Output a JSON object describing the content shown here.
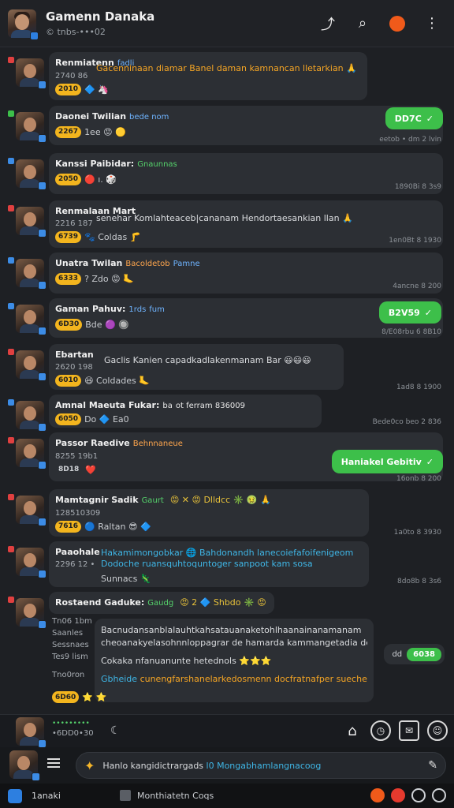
{
  "header": {
    "title": "Gamenn Danaka",
    "subtitle": "© tnbs-•••02"
  },
  "messages": [
    {
      "name": "Renmiatenn",
      "tag": "fadli",
      "sub": "2740 86",
      "text": "Gacenninaan diamar Banel daman kamnancan lletarkian 🙏",
      "react_count": "2010",
      "reacts": "🔷 🦄",
      "dot": "#e04040",
      "time": ""
    },
    {
      "name": "Daonei Twilian",
      "tag": "bede nom",
      "sub": "",
      "text": "",
      "react_count": "2267",
      "reacts": "1ee 😡 🟡",
      "dot": "#3dbf4a",
      "time": "eetob • dm 2 lvin",
      "reply": "DD7C"
    },
    {
      "name": "Kanssi Paibidar:",
      "tag": "Gnaunnas",
      "sub": "",
      "text": "",
      "react_count": "2050",
      "reacts": "🔴 ı. 🎲",
      "dot": "#3c8ce6",
      "time": "1890Bi 8 3s9"
    },
    {
      "name": "Renmalaan Mart",
      "tag": "",
      "sub": "2216 187",
      "text": "senehar Komlahteaceb|cananam Hendortaesankian llan 🙏",
      "react_count": "6739",
      "reacts": "🐾 Coldas 🦵",
      "dot": "#e04040",
      "time": "1en0Bt 8 1930"
    },
    {
      "name": "Unatra Twilan",
      "tag": "Bacoldetob",
      "tag2": "Pamne",
      "sub": "",
      "text": "",
      "react_count": "6333",
      "reacts": "? Zdo 😡 🦶",
      "dot": "#3c8ce6",
      "time": "4ancne 8 200"
    },
    {
      "name": "Gaman Pahuv:",
      "tag": "1rds",
      "tag2": "fum",
      "sub": "",
      "text": "",
      "react_count": "6D30",
      "reacts": "Bde 🟣 🔘",
      "dot": "#3c8ce6",
      "time": "8/E08rbu 6 8B10",
      "reply": "B2V59"
    },
    {
      "name": "Ebartan",
      "tag": "",
      "sub": "2620 198",
      "text": "Gaclis Kanien capadkadlakenmanam Bar 😃😃😃",
      "react_count": "6010",
      "reacts": "😆 Coldades 🦶",
      "dot": "#e04040",
      "time": "1ad8 8 1900"
    },
    {
      "name": "Amnal Maeuta Fukar:",
      "tag": "ba",
      "tag2": "ot ferram 836009",
      "sub": "",
      "text": "",
      "react_count": "6050",
      "reacts": "Do 🔷 Ea0",
      "dot": "#3c8ce6",
      "time": "Bede0co beo 2 836"
    },
    {
      "name": "Passor Raedive",
      "tag": "Behnnaneue",
      "sub": "8255 19b1",
      "text": "",
      "react_count": "8D18",
      "reacts": "❤️",
      "dot": "#e04040",
      "time": "16onb 8 200",
      "reply": "Haniakel Gebitiv"
    },
    {
      "name": "Mamtagnir Sadik",
      "tag": "Gaurt",
      "sub": "128510309",
      "text": "",
      "react_count": "7616",
      "reacts": "🔵 Raltan 😎 🔷",
      "dot": "#e04040",
      "time": "1a0to 8 3930",
      "extra": "😡 ✕ 😡 Dlldcc ✳️ 🤢 🙏"
    },
    {
      "name": "Paaohale",
      "tag": "",
      "sub": "2296 12 •",
      "text": "Hakamimongobkar 🌐 Bahdonandh lanecoiefafoifenigeom",
      "text2": "Dodoche ruansquhtoquntoger sanpoot kam sosa",
      "react_count": "",
      "reacts": "Sunnacs 🦎",
      "dot": "#e04040",
      "time": "8do8b 8 3s6"
    },
    {
      "name": "Rostaend Gaduke:",
      "tag": "Gaudg",
      "sub": "",
      "text": "",
      "react_count": "",
      "reacts": "",
      "dot": "#e04040",
      "time": "",
      "extra": "😡 2 🔷 Shbdo ✳️ 😡"
    }
  ],
  "thread": {
    "labels": [
      "Tn06 1bm",
      "Saanles",
      "Sessnaes",
      "Tes9 lism",
      "Tno0ron"
    ],
    "line1": "Bacnudansanblalauhtkahsatauanaketohlhaanainanamanam",
    "line2": "cheoanakyelasohnnloppagrar de hamarda kammangetadia delkaij",
    "line3": "Cokaka nfanuanunte hetednols ⭐⭐⭐",
    "line4a": "Gbheide",
    "line4b": "cunengfarshanelarkedosmenn docfratnafper sueche",
    "react_count": "6D60",
    "reacts": "⭐ ⭐",
    "side_reply": "dd",
    "side_inner": "6038"
  },
  "composebar": {
    "line1": "•••••••••",
    "line2": "•6DD0•30",
    "reply_icon": "☾"
  },
  "input": {
    "text_main": "Hanlo kangidictrargads ",
    "text_hl": "l0 Mongabhamlangnacoog",
    "send_icon": "pen-icon"
  },
  "statusbar": {
    "app_name": "1anaki",
    "middle": "Monthiatetn Coqs"
  }
}
